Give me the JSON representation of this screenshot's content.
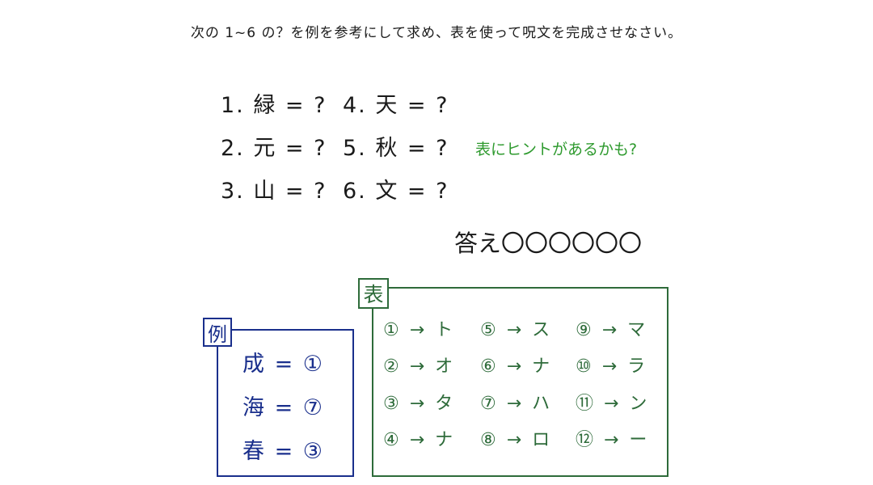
{
  "instruction": "次の 1~6 の？を例を参考にして求め、表を使って呪文を完成させなさい。",
  "questions": [
    "1. 緑 = ?",
    "2. 元 = ?",
    "3. 山 = ?",
    "4. 天 = ?",
    "5. 秋 = ?",
    "6. 文 = ?"
  ],
  "hint": "表にヒントがあるかも?",
  "answer": {
    "label": "答え",
    "blanks": "〇〇〇〇〇〇"
  },
  "example": {
    "tag": "例",
    "lines": [
      "成 = ①",
      "海 = ⑦",
      "春 = ③"
    ]
  },
  "table": {
    "tag": "表",
    "columns": [
      [
        "① → ト",
        "② → オ",
        "③ → タ",
        "④ → ナ"
      ],
      [
        "⑤ → ス",
        "⑥ → ナ",
        "⑦ → ハ",
        "⑧ → ロ"
      ],
      [
        "⑨ → マ",
        "⑩ → ラ",
        "⑪ → ン",
        "⑫ → ー"
      ]
    ]
  },
  "colors": {
    "text": "#1a1a1a",
    "hint": "#2e9a2e",
    "example": "#1a2f8c",
    "table": "#2e6b3a"
  }
}
